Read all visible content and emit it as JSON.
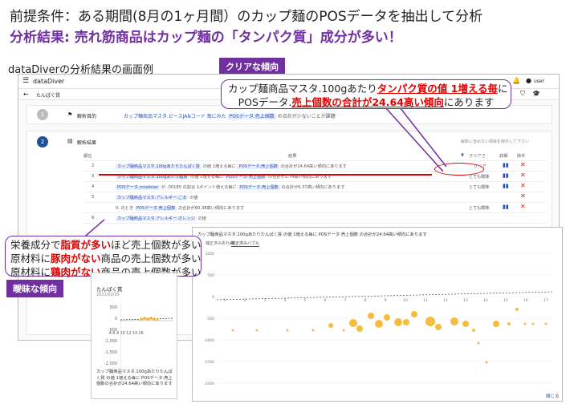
{
  "header": {
    "line1": "前提条件：ある期間(8月の1ヶ月間）のカップ麺のPOSデータを抽出して分析",
    "line2": "分析結果: 売れ筋商品はカップ麺の「タンパク質」成分が多い！"
  },
  "caption": "dataDiverの分析結果の画面例",
  "badges": {
    "clear": "クリアな傾向",
    "vague": "曖昧な傾向"
  },
  "app": {
    "title": "dataDiver",
    "user": "user",
    "breadcrumb": "たんぱく質",
    "purpose": {
      "step": "1",
      "label": "解析目的",
      "text_pre": "カップ麺商品マスタ.ピースJANコード 毎にみた",
      "chip": "POSデータ.売上個数",
      "text_post": "の合計が少ないことが課題"
    },
    "result": {
      "step": "2",
      "label": "解析結果",
      "note": "解析に含めない項目を除外して下さい",
      "columns": [
        "順位",
        "結果",
        "クリアさ",
        "詳細",
        "除外"
      ],
      "rows": [
        {
          "rank": "2",
          "a": "カップ麺商品マスタ.100gあたりたんぱく質",
          "b": "の値 1増える毎に",
          "c": "POSデータ.売上個数",
          "d": "の合計が24.64高い傾向にあります",
          "clarity": "クリア"
        },
        {
          "rank": "3",
          "a": "カップ麺商品マスタ.100gあたり脂質",
          "b": "の値 1増える毎に",
          "c": "POSデータ.売上個数",
          "d": "の合計が1.74高い傾向にあります",
          "clarity": "とても曖昧"
        },
        {
          "rank": "4",
          "a": "POSデータ.misebian",
          "b": "が .00185 の割合 1ポイント増える毎に",
          "c": "POSデータ.売上個数",
          "d": "の合計が6.37高い傾向にあります",
          "clarity": "とても曖昧"
        },
        {
          "rank": "5",
          "a": "カップ麺商品マスタ.アレルギー:ごま",
          "b": "の値",
          "c": "",
          "d": "",
          "clarity": ""
        },
        {
          "rank": "",
          "a": "0. のとき",
          "b": "POSデータ.売上個数",
          "c": "",
          "d": "の合計が60.38高い傾向にあります",
          "clarity": "とても曖昧"
        },
        {
          "rank": "6",
          "a": "カップ麺商品マスタ.アレルギー:オレンジ",
          "b": "の値",
          "c": "",
          "d": "",
          "clarity": ""
        }
      ]
    }
  },
  "callout_top": {
    "l1_pre": "カップ麺商品マスタ.100gあたり",
    "l1_red": "タンパク質の値 1増える毎",
    "l1_post": "に",
    "l2_pre": "POSデータ.",
    "l2_red": "売上個数の合計が24.64高い傾向",
    "l2_post": "にあります"
  },
  "callout_left": {
    "r1_pre": "栄養成分で",
    "r1_red": "脂質が多い",
    "r1_post": "ほど売上個数が多い",
    "r2_pre": "原材料に",
    "r2_red": "豚肉がない",
    "r2_post": "商品の売上個数が多い",
    "r3_pre": "原材料に",
    "r3_red": "鶏肉がない",
    "r3_post": "商品の売上個数が多い"
  },
  "mini_card": {
    "title": "たんぱく質",
    "date": "2021/02/05",
    "y_ticks": [
      "500",
      "0",
      "-500",
      "-1,000",
      "-1,500",
      "-2,000"
    ],
    "x_ticks": "-4-6 8 10 12 14 16",
    "rank_labels": [
      "9",
      "10"
    ],
    "desc": "カップ麺商品マスタ.100gあたりたんぱく質 の値 1増える毎に POSデータ.売上個数の合計が24.64高い傾向にあります"
  },
  "big_window": {
    "title": "カップ麺商品マスタ.100gあたりたんぱく質 の値 1増える毎に POSデータ.売上個数 の合計が24.64高い傾向にあります",
    "tabs": [
      "補正済み折れ線",
      "補正済みバブル"
    ],
    "y_ticks": [
      "1000",
      "500",
      "0",
      "-500",
      "-1000",
      "-1500",
      "-2000"
    ],
    "x_ticks": [
      "1",
      "2",
      "3",
      "4",
      "5",
      "6",
      "7",
      "8",
      "9",
      "10",
      "11",
      "12",
      "13",
      "14",
      "15",
      "16",
      "17"
    ],
    "close": "閉じる"
  },
  "colors": {
    "accent": "#7030a0",
    "red": "#e00000",
    "bubble": "#f5b52a",
    "chip": "#2a4fa8"
  }
}
